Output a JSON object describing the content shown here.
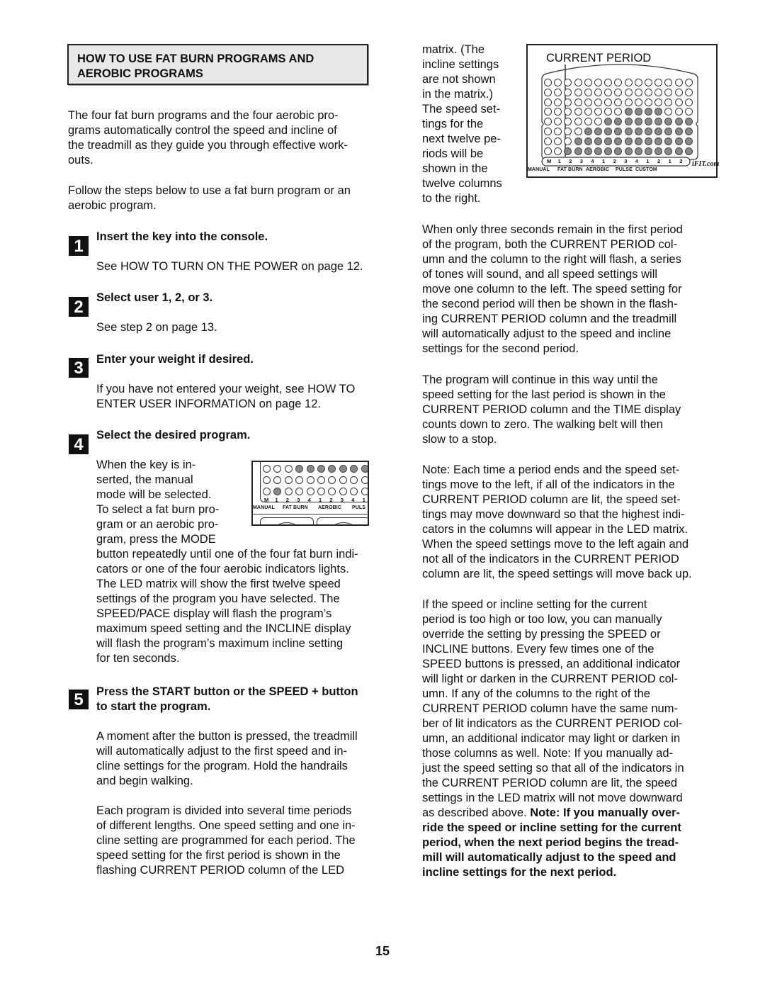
{
  "page": {
    "number": "15"
  },
  "heading": {
    "line1": "HOW TO USE FAT BURN PROGRAMS AND",
    "line2": "AEROBIC PROGRAMS"
  },
  "intro": {
    "p1": [
      "The four fat burn programs and the four aerobic pro-",
      "grams automatically control the speed and incline of",
      "the treadmill as they guide you through effective work-",
      "outs."
    ],
    "p2": [
      "Follow the steps below to use a fat burn program or an",
      "aerobic program."
    ]
  },
  "steps": [
    {
      "number": "1",
      "title": "Insert the key into the console.",
      "body": [
        "See HOW TO TURN ON THE POWER on page 12."
      ]
    },
    {
      "number": "2",
      "title": "Select user 1, 2, or 3.",
      "body": [
        "See step 2 on page 13."
      ]
    },
    {
      "number": "3",
      "title": "Enter your weight if desired.",
      "body": [
        "If you have not entered your weight, see HOW TO",
        "ENTER USER INFORMATION on page 12."
      ]
    },
    {
      "number": "4",
      "title": "Select the desired program.",
      "body_wrap": [
        "When the key is in-",
        "serted, the manual",
        "mode will be selected.",
        "To select a fat burn pro-",
        "gram or an aerobic pro-",
        "gram, press the MODE"
      ],
      "body": [
        "button repeatedly until one of the four fat burn indi-",
        "cators or one of the four aerobic indicators lights.",
        "The LED matrix will show the first twelve speed",
        "settings of the program you have selected. The",
        "SPEED/PACE display will flash the program’s",
        "maximum speed setting and the INCLINE display",
        "will flash the program’s maximum incline setting",
        "for ten seconds."
      ]
    },
    {
      "number": "5",
      "title_lines": [
        "Press the START button or the SPEED + button",
        "to start the program."
      ],
      "body": [
        "A moment after the button is pressed, the treadmill",
        "will automatically adjust to the first speed and in-",
        "cline settings for the program. Hold the handrails",
        "and begin walking."
      ],
      "body2": [
        "Each program is divided into several time periods",
        "of different lengths. One speed setting and one in-",
        "cline setting are programmed for each period. The",
        "speed setting for the first period is shown in the",
        "flashing CURRENT PERIOD column of the LED"
      ]
    }
  ],
  "right_column": {
    "wrap_text": [
      "matrix. (The",
      "incline settings",
      "are not shown",
      "in the matrix.)",
      "The speed set-",
      "tings for the",
      "next twelve pe-",
      "riods will be",
      "shown in the",
      "twelve columns",
      "to the right."
    ],
    "p1": [
      "When only three seconds remain in the first period",
      "of the program, both the CURRENT PERIOD col-",
      "umn and the column to the right will flash, a series",
      "of tones will sound, and all speed settings will",
      "move one column to the left. The speed setting for",
      "the second period will then be shown in the flash-",
      "ing CURRENT PERIOD column and the treadmill",
      "will automatically adjust to the speed and incline",
      "settings for the second period."
    ],
    "p2": [
      "The program will continue in this way until the",
      "speed setting for the last period is shown in the",
      "CURRENT PERIOD column and the TIME display",
      "counts down to zero. The walking belt will then",
      "slow to a stop."
    ],
    "p3": [
      "Note: Each time a period ends and the speed set-",
      "tings move to the left, if all of the indicators in the",
      "CURRENT PERIOD column are lit, the speed set-",
      "tings may move downward so that the highest indi-",
      "cators in the columns will appear in the LED matrix.",
      "When the speed settings move to the left again and",
      "not all of the indicators in the CURRENT PERIOD",
      "column are lit, the speed settings will move back up."
    ],
    "p4": [
      "If the speed or incline setting for the current",
      "period is too high or too low, you can manually",
      "override the setting by pressing the SPEED or",
      "INCLINE buttons. Every few times one of the",
      "SPEED buttons is pressed, an additional indicator",
      "will light or darken in the CURRENT PERIOD col-",
      "umn. If any of the columns to the right of the",
      "CURRENT PERIOD column have the same num-",
      "ber of lit indicators as the CURRENT PERIOD col-",
      "umn, an additional indicator may light or darken in",
      "those columns as well. Note: If you manually ad-",
      "just the speed setting so that all of the indicators in",
      "the CURRENT PERIOD column are lit, the speed",
      "settings in the LED matrix will not move downward"
    ],
    "p4_last_plain": "as described above. ",
    "p4_last_bold": "Note: If you manually over-",
    "p4_bold_lines": [
      "ride the speed or incline setting for the current",
      "period, when the next period begins the tread-",
      "mill will automatically adjust to the speed and",
      "incline settings for the next period."
    ]
  },
  "figure_large": {
    "callout": "CURRENT PERIOD",
    "rows": 8,
    "cols": 15,
    "lit_counts_per_column": [
      0,
      0,
      1,
      2,
      3,
      3,
      4,
      4,
      5,
      5,
      5,
      5,
      4,
      4,
      4
    ],
    "column_labels": [
      "M",
      "1",
      "2",
      "3",
      "4",
      "1",
      "2",
      "3",
      "4",
      "1",
      "2",
      "1",
      "2"
    ],
    "categories": [
      "MANUAL",
      "FAT BURN",
      "AEROBIC",
      "PULSE",
      "CUSTOM"
    ],
    "logo": "iFIT.com"
  },
  "figure_small": {
    "rows": 3,
    "cols": 10,
    "lit": [
      [
        0,
        0,
        0,
        1,
        1,
        1,
        1,
        1,
        1,
        1
      ],
      [
        0,
        0,
        0,
        0,
        0,
        0,
        0,
        0,
        0,
        0
      ],
      [
        0,
        1,
        0,
        0,
        0,
        0,
        0,
        0,
        0,
        0
      ]
    ],
    "column_labels": [
      "M",
      "1",
      "2",
      "3",
      "4",
      "1",
      "2",
      "3",
      "4",
      "1"
    ],
    "categories": [
      "MANUAL",
      "FAT BURN",
      "AEROBIC",
      "PULS"
    ]
  }
}
